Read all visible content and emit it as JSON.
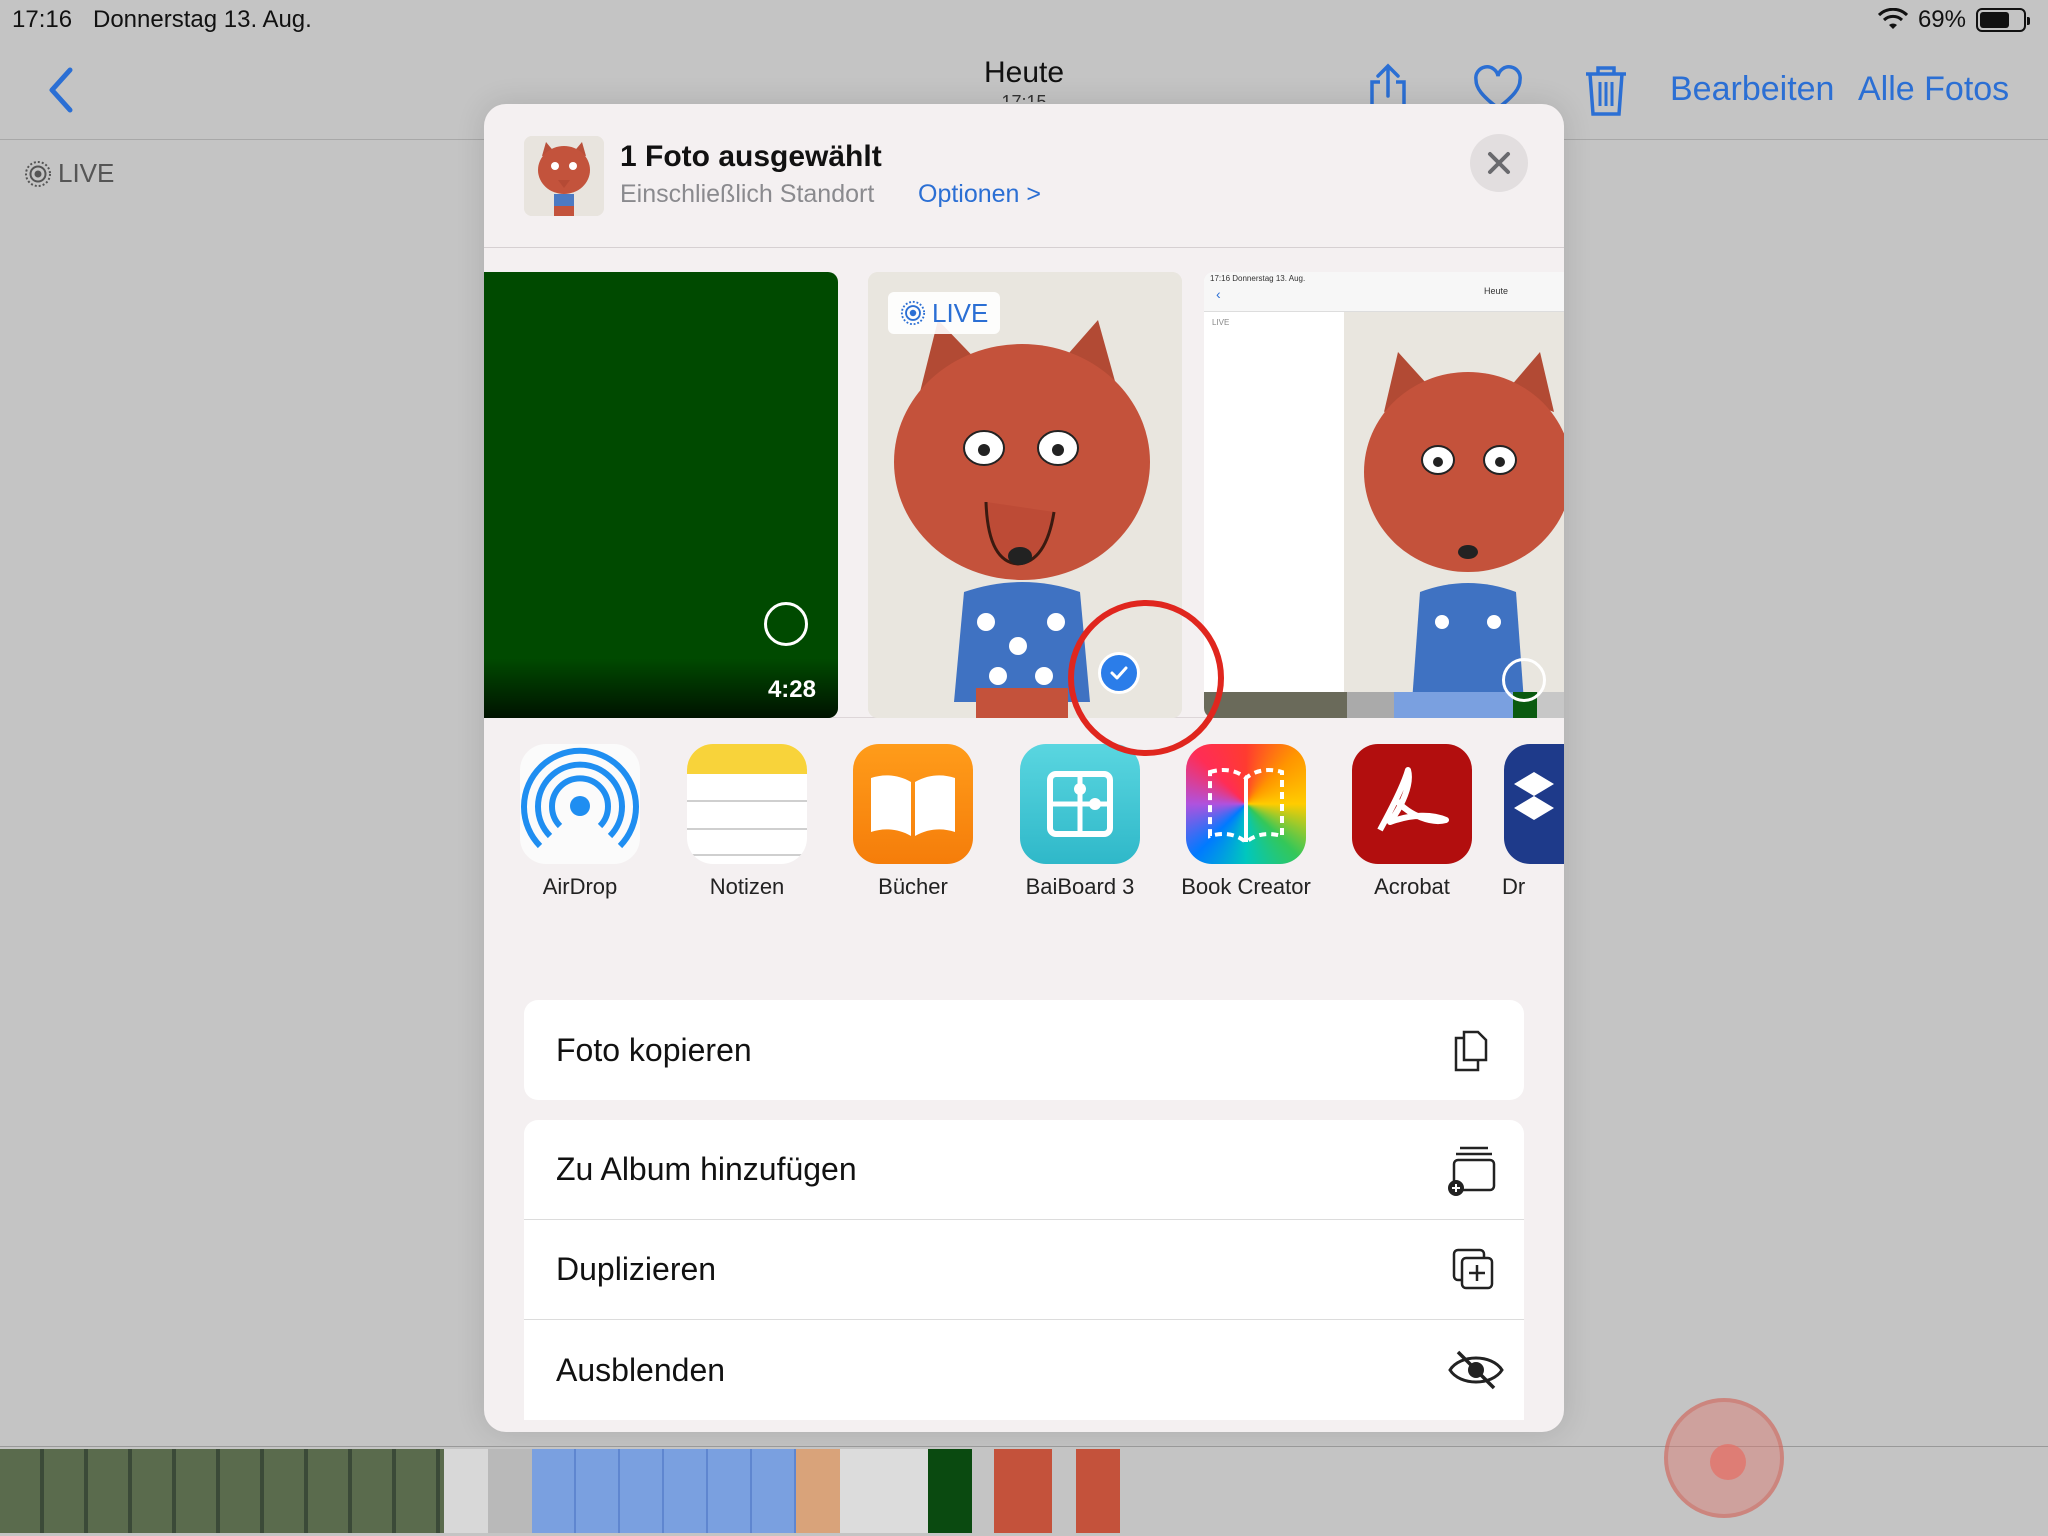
{
  "status": {
    "time": "17:16",
    "date": "Donnerstag 13. Aug.",
    "battery": "69%",
    "battery_level": 0.69
  },
  "nav": {
    "title": "Heute",
    "subtitle": "17:15",
    "edit": "Bearbeiten",
    "all_photos": "Alle Fotos"
  },
  "background": {
    "live_label": "LIVE"
  },
  "sheet": {
    "title": "1 Foto ausgewählt",
    "subtitle": "Einschließlich Standort",
    "options": "Optionen >",
    "video_duration": "4:28",
    "live_label": "LIVE",
    "apps": [
      {
        "label": "AirDrop",
        "icon": "airdrop-icon"
      },
      {
        "label": "Notizen",
        "icon": "notes-icon"
      },
      {
        "label": "Bücher",
        "icon": "books-icon"
      },
      {
        "label": "BaiBoard 3",
        "icon": "baiboard-icon"
      },
      {
        "label": "Book Creator",
        "icon": "book-creator-icon"
      },
      {
        "label": "Acrobat",
        "icon": "acrobat-icon"
      },
      {
        "label": "Dr",
        "icon": "dropbox-icon"
      }
    ],
    "actions_group1": [
      {
        "label": "Foto kopieren",
        "icon": "copy-icon"
      }
    ],
    "actions_group2": [
      {
        "label": "Zu Album hinzufügen",
        "icon": "add-album-icon"
      },
      {
        "label": "Duplizieren",
        "icon": "duplicate-icon"
      },
      {
        "label": "Ausblenden",
        "icon": "hide-eye-icon"
      }
    ]
  },
  "screenshot_thumb": {
    "date_line": "17:16   Donnerstag 13. Aug.",
    "title": "Heute",
    "live": "LIVE"
  },
  "colors": {
    "accent": "#2b6fd4",
    "highlight_circle": "#e0261e",
    "video_bg": "#004a00"
  }
}
